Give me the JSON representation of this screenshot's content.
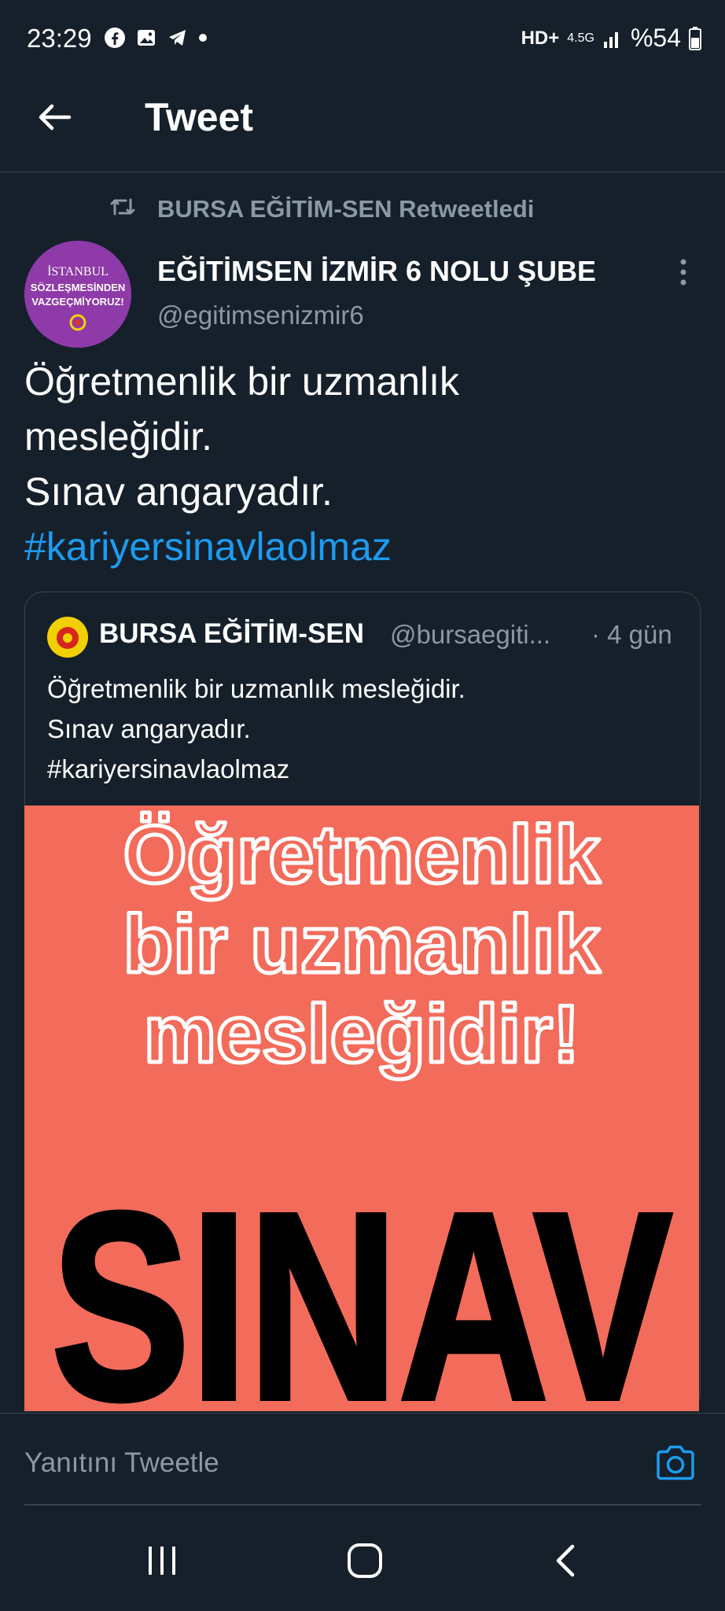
{
  "status_bar": {
    "time": "23:29",
    "left_icons": [
      "facebook-icon",
      "gallery-icon",
      "telegram-icon",
      "dot-icon"
    ],
    "network_hd": "HD+",
    "network_type": "4.5G",
    "battery": "%54"
  },
  "header": {
    "title": "Tweet",
    "back_icon": "arrow-left-icon"
  },
  "retweet": {
    "text": "BURSA EĞİTİM-SEN Retweetledi"
  },
  "author": {
    "name": "EĞİTİMSEN İZMİR 6 NOLU ŞUBE",
    "handle": "@egitimsenizmir6",
    "avatar_text": [
      "İSTANBUL",
      "SÖZLEŞMESİNDEN",
      "VAZGEÇMİYORUZ!"
    ]
  },
  "tweet": {
    "lines": [
      "Öğretmenlik bir uzmanlık",
      "mesleğidir.",
      "Sınav angaryadır."
    ],
    "hashtag": "#kariyersinavlaolmaz"
  },
  "quote": {
    "name": "BURSA EĞİTİM-SEN",
    "handle": "@bursaegiti...",
    "time": "· 4 gün",
    "lines": [
      "Öğretmenlik bir uzmanlık mesleğidir.",
      "Sınav angaryadır.",
      "#kariyersinavlaolmaz"
    ],
    "image": {
      "line1": "Öğretmenlik",
      "line2": "bir uzmanlık",
      "line3": "mesleğidir!",
      "line4": "SINAV",
      "bg_color": "#f26b5b"
    }
  },
  "reply": {
    "placeholder": "Yanıtını Tweetle"
  },
  "colors": {
    "background": "#15202b",
    "accent": "#1d9bf0",
    "muted": "#8b98a5",
    "border": "#38444d"
  }
}
